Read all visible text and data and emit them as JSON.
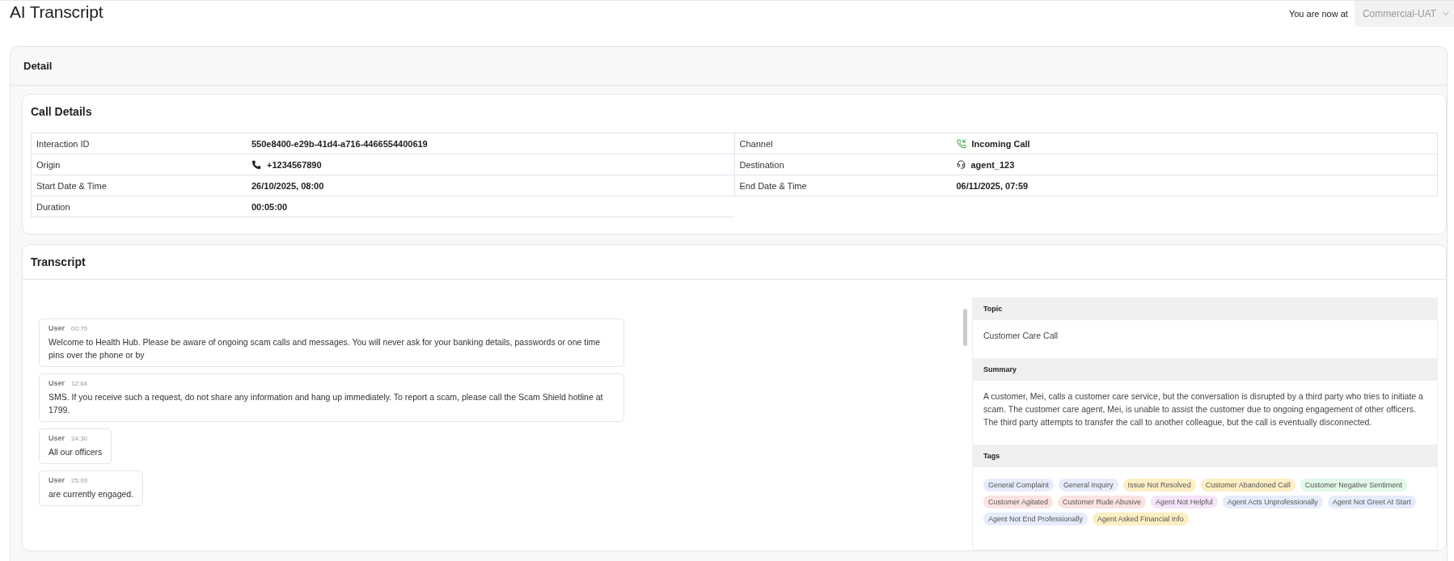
{
  "page": {
    "title": "AI Transcript",
    "env_label": "You are now at",
    "env_value": "Commercial-UAT"
  },
  "detail": {
    "title": "Detail"
  },
  "call_details": {
    "title": "Call Details",
    "left": [
      {
        "label": "Interaction ID",
        "value": "550e8400-e29b-41d4-a716-4466554400619"
      },
      {
        "label": "Origin",
        "value": "+1234567890",
        "kind": "phone"
      },
      {
        "label": "Start Date & Time",
        "value": "26/10/2025, 08:00"
      },
      {
        "label": "Duration",
        "value": "00:05:00"
      }
    ],
    "right": [
      {
        "label": "Channel",
        "value": "Incoming Call",
        "kind": "incoming"
      },
      {
        "label": "Destination",
        "value": "agent_123",
        "kind": "agent"
      },
      {
        "label": "End Date & Time",
        "value": "06/11/2025, 07:59"
      }
    ]
  },
  "transcript": {
    "title": "Transcript",
    "messages": [
      {
        "speaker": "User",
        "time": "00:70",
        "text": "Welcome to Health Hub. Please be aware of ongoing scam calls and messages. You will never ask for your banking details, passwords or one time pins over the phone or by"
      },
      {
        "speaker": "User",
        "time": "12:64",
        "text": "SMS. If you receive such a request, do not share any information and hang up immediately. To report a scam, please call the Scam Shield hotline at 1799."
      },
      {
        "speaker": "User",
        "time": "24:30",
        "text": "All our officers"
      },
      {
        "speaker": "User",
        "time": "25:93",
        "text": "are currently engaged."
      }
    ],
    "topic": {
      "heading": "Topic",
      "value": "Customer Care Call"
    },
    "summary": {
      "heading": "Summary",
      "value": "A customer, Mei, calls a customer care service, but the conversation is disrupted by a third party who tries to initiate a scam. The customer care agent, Mei, is unable to assist the customer due to ongoing engagement of other officers. The third party attempts to transfer the call to another colleague, but the call is eventually disconnected."
    },
    "tags": {
      "heading": "Tags",
      "items": [
        {
          "label": "General Complaint",
          "color": "#e6ecfb"
        },
        {
          "label": "General Inquiry",
          "color": "#e6ecfb"
        },
        {
          "label": "Issue Not Resolved",
          "color": "#fcefc4"
        },
        {
          "label": "Customer Abandoned Call",
          "color": "#fcefc4"
        },
        {
          "label": "Customer Negative Sentiment",
          "color": "#e2f8e9"
        },
        {
          "label": "Customer Agitated",
          "color": "#fde2e2"
        },
        {
          "label": "Customer Rude Abusive",
          "color": "#fde2e2"
        },
        {
          "label": "Agent Not Helpful",
          "color": "#f7e4fb"
        },
        {
          "label": "Agent Acts Unprofessionally",
          "color": "#e6ecfb"
        },
        {
          "label": "Agent Not Greet At Start",
          "color": "#e6ecfb"
        },
        {
          "label": "Agent Not End Professionally",
          "color": "#e6ecfb"
        },
        {
          "label": "Agent Asked Financial Info",
          "color": "#fcefc4"
        }
      ]
    }
  }
}
